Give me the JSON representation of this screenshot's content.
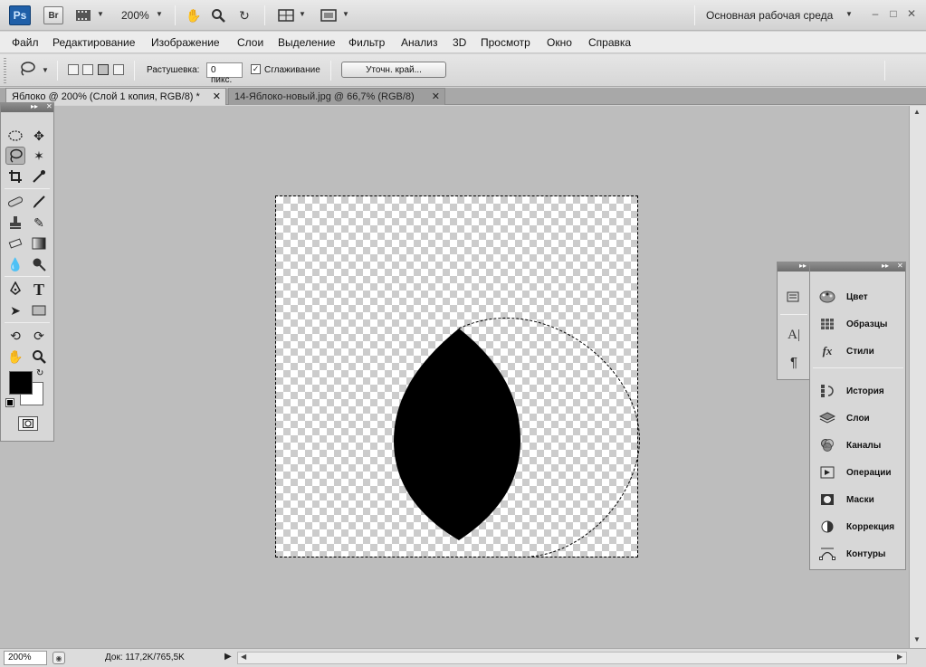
{
  "appbar": {
    "ps_logo": "Ps",
    "br_logo": "Br",
    "zoom": "200%",
    "workspace": "Основная рабочая среда",
    "icons": [
      "film-icon",
      "hand-icon",
      "zoom-icon",
      "rotate-view-icon",
      "arrange-icon",
      "screen-mode-icon"
    ]
  },
  "menu": [
    "Файл",
    "Редактирование",
    "Изображение",
    "Слои",
    "Выделение",
    "Фильтр",
    "Анализ",
    "3D",
    "Просмотр",
    "Окно",
    "Справка"
  ],
  "options": {
    "feather_label": "Растушевка:",
    "feather_value": "0 пикс.",
    "antialias_label": "Сглаживание",
    "antialias_checked": "✓",
    "refine_button": "Уточн. край..."
  },
  "tabs": [
    {
      "label": "Яблоко @ 200% (Слой 1 копия, RGB/8) *",
      "close": "✕"
    },
    {
      "label": "14-Яблоко-новый.jpg @ 66,7% (RGB/8)",
      "close": "✕"
    }
  ],
  "status": {
    "zoom": "200%",
    "doc": "Док: 117,2K/765,5K"
  },
  "dock": {
    "group1": [
      {
        "icon": "palette-icon",
        "label": "Цвет"
      },
      {
        "icon": "swatches-icon",
        "label": "Образцы"
      },
      {
        "icon": "styles-icon",
        "label": "Стили"
      }
    ],
    "group2": [
      {
        "icon": "history-icon",
        "label": "История"
      },
      {
        "icon": "layers-icon",
        "label": "Слои"
      },
      {
        "icon": "channels-icon",
        "label": "Каналы"
      },
      {
        "icon": "actions-icon",
        "label": "Операции"
      },
      {
        "icon": "masks-icon",
        "label": "Маски"
      },
      {
        "icon": "adjustments-icon",
        "label": "Коррекция"
      },
      {
        "icon": "paths-icon",
        "label": "Контуры"
      }
    ]
  },
  "colors": {
    "foreground": "#000000",
    "background": "#ffffff",
    "canvas_bg": "#bdbdbd"
  }
}
